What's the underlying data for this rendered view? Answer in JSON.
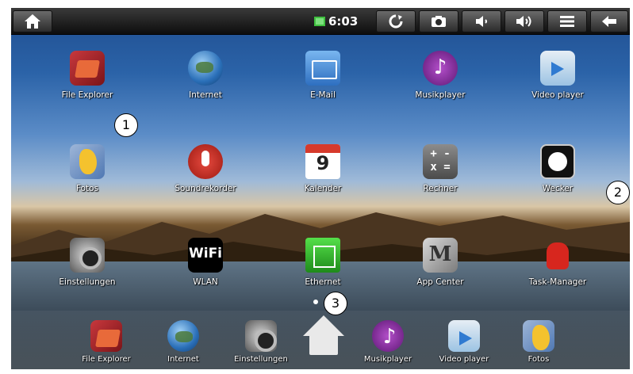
{
  "statusbar": {
    "time": "6:03",
    "icons": [
      "home-icon",
      "battery-icon",
      "refresh-icon",
      "camera-icon",
      "volume-down-icon",
      "volume-up-icon",
      "menu-icon",
      "back-icon"
    ]
  },
  "apps": [
    {
      "label": "File Explorer",
      "icon": "folder-icon"
    },
    {
      "label": "Internet",
      "icon": "globe-icon"
    },
    {
      "label": "E-Mail",
      "icon": "mail-icon"
    },
    {
      "label": "Musikplayer",
      "icon": "music-icon"
    },
    {
      "label": "Video player",
      "icon": "video-icon"
    },
    {
      "label": "Fotos",
      "icon": "photos-icon"
    },
    {
      "label": "Soundrekorder",
      "icon": "microphone-icon"
    },
    {
      "label": "Kalender",
      "icon": "calendar-icon",
      "day": "9"
    },
    {
      "label": "Rechner",
      "icon": "calculator-icon"
    },
    {
      "label": "Wecker",
      "icon": "clock-icon"
    },
    {
      "label": "Einstellungen",
      "icon": "settings-icon"
    },
    {
      "label": "WLAN",
      "icon": "wifi-icon"
    },
    {
      "label": "Ethernet",
      "icon": "ethernet-icon"
    },
    {
      "label": "App Center",
      "icon": "app-center-icon"
    },
    {
      "label": "Task-Manager",
      "icon": "android-icon"
    }
  ],
  "dock": [
    {
      "label": "File Explorer",
      "icon": "folder-icon"
    },
    {
      "label": "Internet",
      "icon": "globe-icon"
    },
    {
      "label": "Einstellungen",
      "icon": "settings-icon"
    },
    {
      "label": "Musikplayer",
      "icon": "music-icon"
    },
    {
      "label": "Video player",
      "icon": "video-icon"
    },
    {
      "label": "Fotos",
      "icon": "photos-icon"
    }
  ],
  "callouts": [
    "1",
    "2",
    "3"
  ],
  "colors": {
    "statusbar": "#111111",
    "label_text": "#ffffff"
  }
}
